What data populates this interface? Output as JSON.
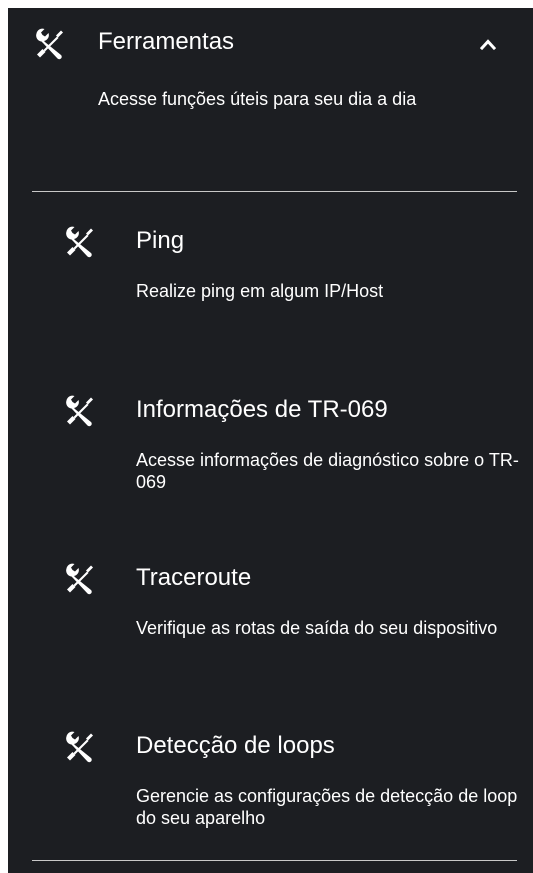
{
  "header": {
    "icon": "tools-icon",
    "title": "Ferramentas",
    "description": "Acesse funções úteis para seu dia a dia",
    "toggle_icon": "chevron-up-icon",
    "expanded": true
  },
  "tools": [
    {
      "icon": "tools-icon",
      "title": "Ping",
      "description": "Realize ping em algum IP/Host"
    },
    {
      "icon": "tools-icon",
      "title": "Informações de TR-069",
      "description": "Acesse informações de diagnóstico sobre o TR-069"
    },
    {
      "icon": "tools-icon",
      "title": "Traceroute",
      "description": "Verifique as rotas de saída do seu dispositivo"
    },
    {
      "icon": "tools-icon",
      "title": "Detecção de loops",
      "description": "Gerencie as configurações de detecção de loop do seu aparelho"
    }
  ],
  "colors": {
    "panel_background": "#1c1e22",
    "text": "#ffffff",
    "divider": "#c8c8c8"
  }
}
